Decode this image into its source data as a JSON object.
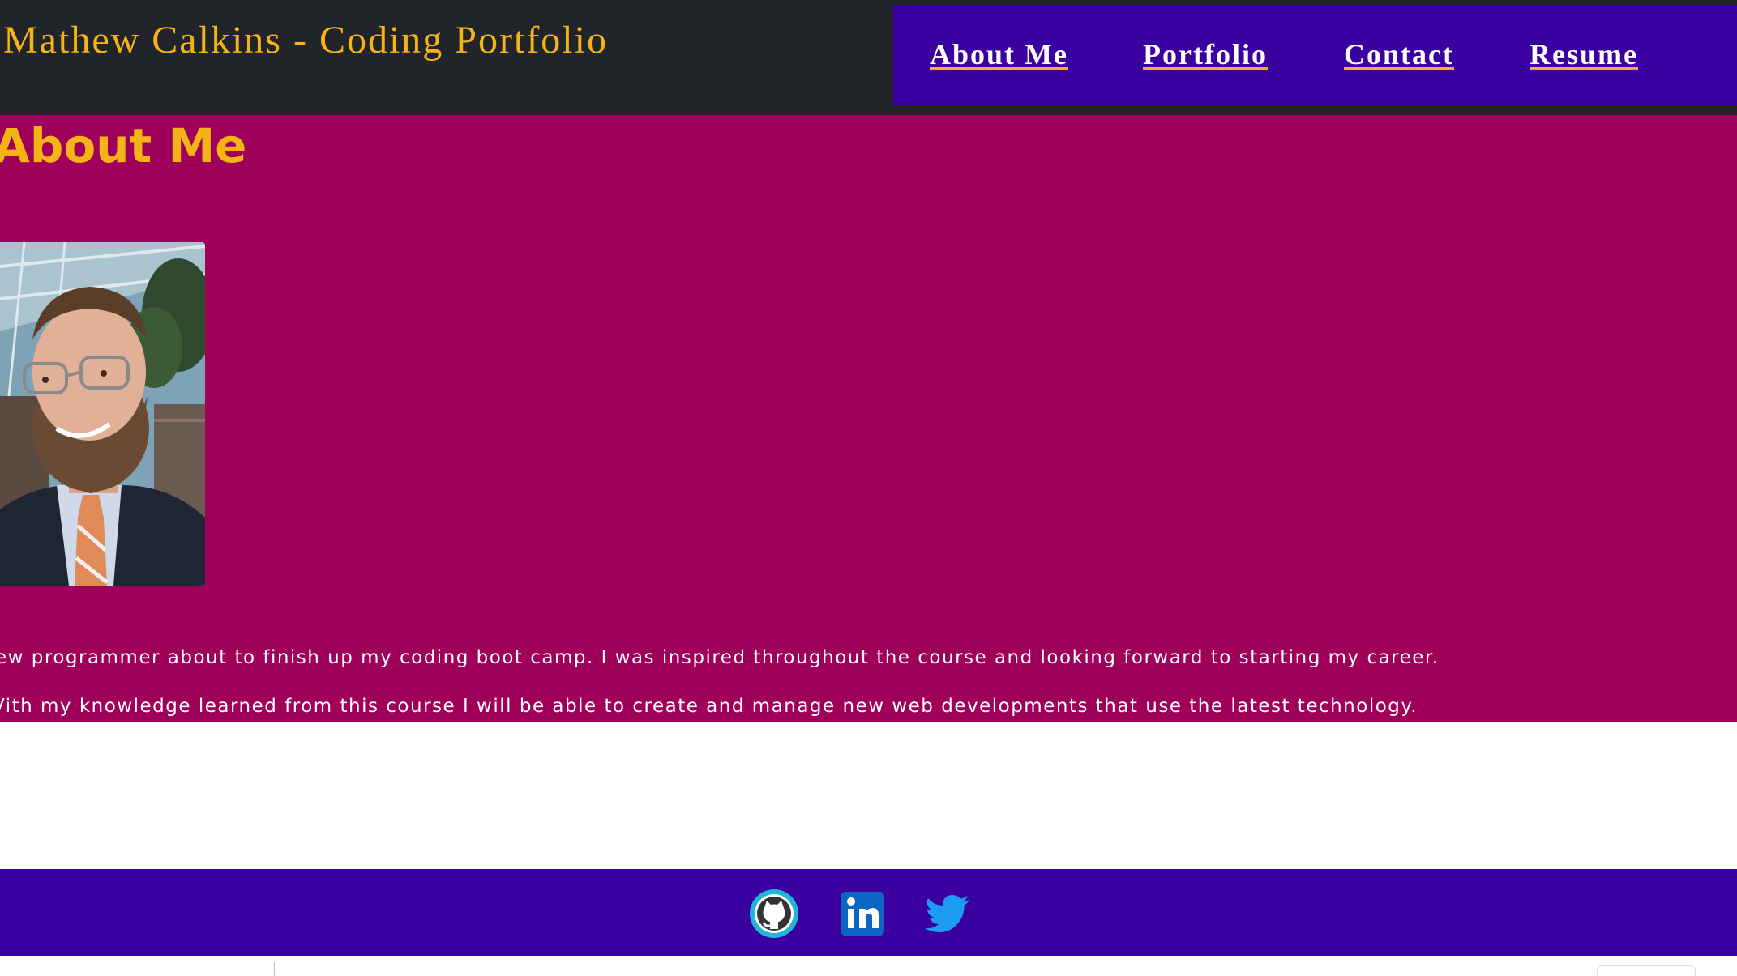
{
  "header": {
    "title": "Mathew Calkins - Coding Portfolio",
    "nav": {
      "about": "About Me",
      "portfolio": "Portfolio",
      "contact": "Contact",
      "resume": "Resume"
    }
  },
  "about": {
    "heading": "About Me",
    "bio_line_1": "ew programmer about to finish up my coding boot camp. I was inspired throughout the course and looking forward to starting my career.",
    "bio_line_2": "Vith my knowledge learned from this course I will be able to create and manage new web developments that use the latest technology."
  },
  "footer": {
    "icons": [
      "github-icon",
      "linkedin-icon",
      "twitter-icon"
    ]
  },
  "colors": {
    "header_bg": "#212529",
    "nav_bg": "#3a00a0",
    "accent": "#f5b416",
    "about_bg": "#9e005a",
    "footer_bg": "#3a00a0"
  }
}
